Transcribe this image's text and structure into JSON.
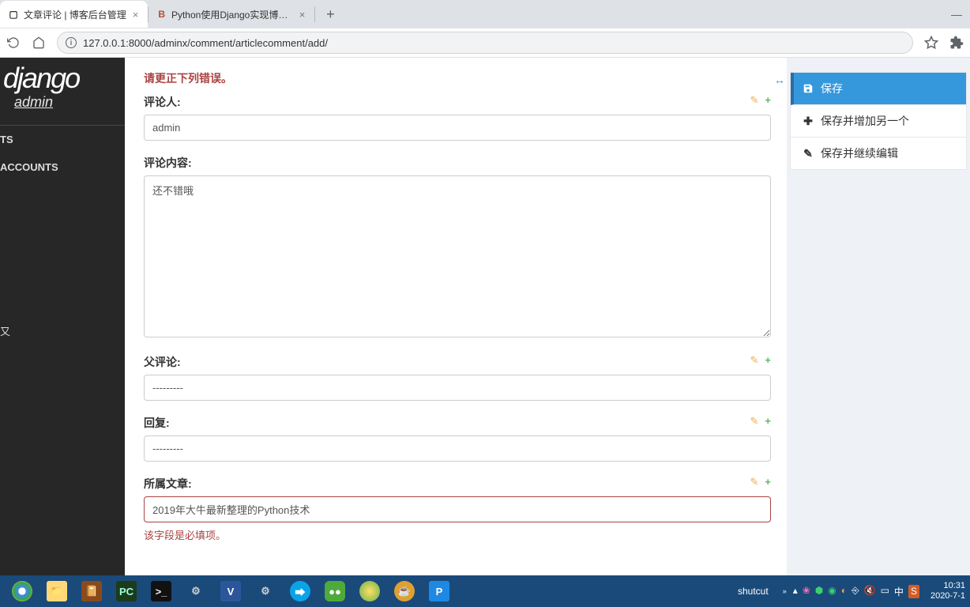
{
  "browser": {
    "tabs": [
      {
        "title": "文章评论 | 博客后台管理",
        "favicon": "□"
      },
      {
        "title": "Python使用Django实现博客系统",
        "favicon": "B"
      }
    ],
    "url": "127.0.0.1:8000/adminx/comment/articlecomment/add/"
  },
  "sidebar": {
    "logo": "django",
    "sub": "admin",
    "items": [
      "TS",
      "ACCOUNTS",
      "又"
    ]
  },
  "form": {
    "error_banner": "请更正下列错误。",
    "commenter_label": "评论人:",
    "commenter_value": "admin",
    "content_label": "评论内容:",
    "content_value": "还不错哦",
    "parent_label": "父评论:",
    "parent_value": "---------",
    "reply_label": "回复:",
    "reply_value": "---------",
    "article_label": "所属文章:",
    "article_value": "2019年大牛最新整理的Python技术",
    "article_error": "该字段是必填项。"
  },
  "actions": {
    "save": "保存",
    "save_add": "保存并增加另一个",
    "save_continue": "保存并继续编辑"
  },
  "taskbar": {
    "shutcut": "shutcut",
    "time": "10:31",
    "date": "2020-7-1"
  }
}
